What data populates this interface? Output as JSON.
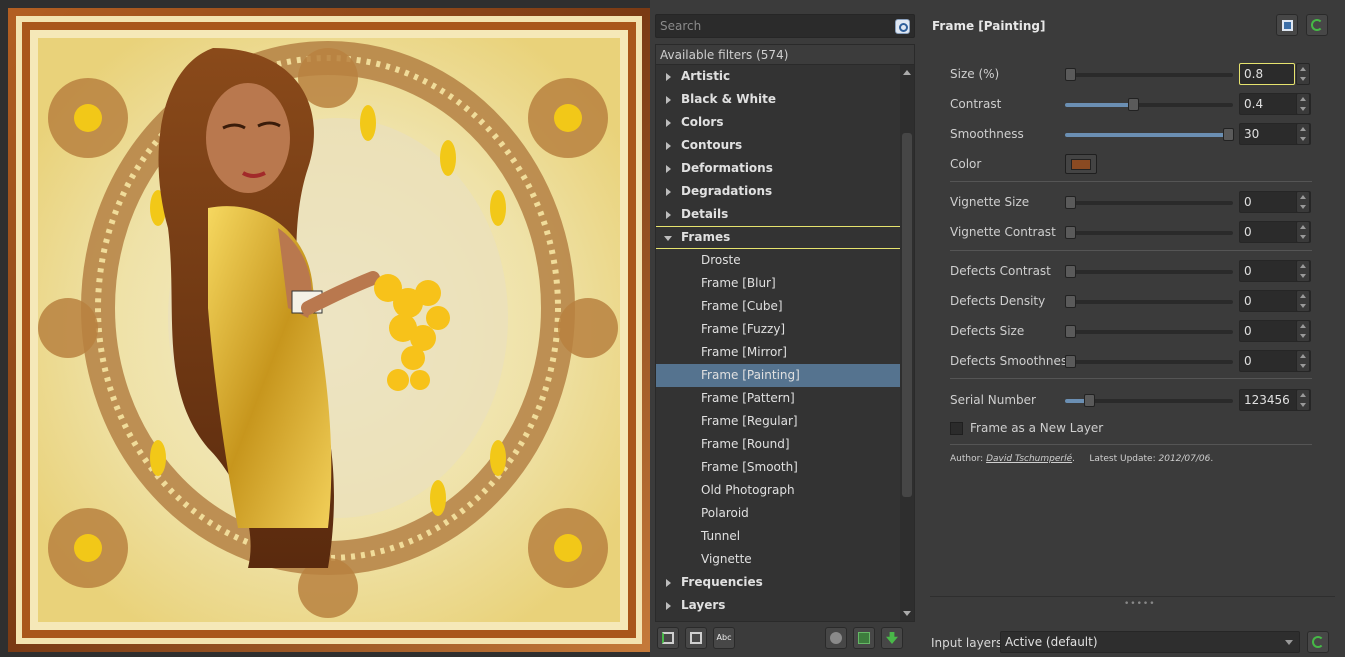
{
  "search": {
    "placeholder": "Search"
  },
  "tree": {
    "header": "Available filters (574)",
    "items": [
      {
        "label": "Artistic",
        "kind": "category",
        "open": false
      },
      {
        "label": "Black & White",
        "kind": "category",
        "open": false
      },
      {
        "label": "Colors",
        "kind": "category",
        "open": false
      },
      {
        "label": "Contours",
        "kind": "category",
        "open": false
      },
      {
        "label": "Deformations",
        "kind": "category",
        "open": false
      },
      {
        "label": "Degradations",
        "kind": "category",
        "open": false
      },
      {
        "label": "Details",
        "kind": "category",
        "open": false
      },
      {
        "label": "Frames",
        "kind": "category",
        "open": true
      },
      {
        "label": "Droste",
        "kind": "filter"
      },
      {
        "label": "Frame [Blur]",
        "kind": "filter"
      },
      {
        "label": "Frame [Cube]",
        "kind": "filter"
      },
      {
        "label": "Frame [Fuzzy]",
        "kind": "filter"
      },
      {
        "label": "Frame [Mirror]",
        "kind": "filter"
      },
      {
        "label": "Frame [Painting]",
        "kind": "filter",
        "selected": true
      },
      {
        "label": "Frame [Pattern]",
        "kind": "filter"
      },
      {
        "label": "Frame [Regular]",
        "kind": "filter"
      },
      {
        "label": "Frame [Round]",
        "kind": "filter"
      },
      {
        "label": "Frame [Smooth]",
        "kind": "filter"
      },
      {
        "label": "Old Photograph",
        "kind": "filter"
      },
      {
        "label": "Polaroid",
        "kind": "filter"
      },
      {
        "label": "Tunnel",
        "kind": "filter"
      },
      {
        "label": "Vignette",
        "kind": "filter"
      },
      {
        "label": "Frequencies",
        "kind": "category",
        "open": false
      },
      {
        "label": "Layers",
        "kind": "category",
        "open": false
      }
    ]
  },
  "tools": {
    "bottom_left": [
      "add-favorite-icon",
      "remove-favorite-icon",
      "rename-icon"
    ],
    "bottom_right": [
      "preview-icon",
      "grid-icon",
      "update-icon"
    ],
    "abc_label": "Abc"
  },
  "params": {
    "title": "Frame [Painting]",
    "rows": [
      {
        "label": "Size (%)",
        "value": "0.8",
        "fraction": 0.0
      },
      {
        "label": "Contrast",
        "value": "0.4",
        "fraction": 0.4
      },
      {
        "label": "Smoothness",
        "value": "30",
        "fraction": 1.0
      },
      {
        "label": "Vignette Size",
        "value": "0",
        "fraction": 0.0
      },
      {
        "label": "Vignette Contrast",
        "value": "0",
        "fraction": 0.0
      },
      {
        "label": "Defects Contrast",
        "value": "0",
        "fraction": 0.0
      },
      {
        "label": "Defects Density",
        "value": "0",
        "fraction": 0.0
      },
      {
        "label": "Defects Size",
        "value": "0",
        "fraction": 0.0
      },
      {
        "label": "Defects Smoothness",
        "value": "0",
        "fraction": 0.0
      },
      {
        "label": "Serial Number",
        "value": "123456",
        "fraction": 0.12
      }
    ],
    "color_label": "Color",
    "color_value": "#8a4a22",
    "checkbox_label": "Frame as a New Layer",
    "author_prefix": "Author:",
    "author_name": "David Tschumperlé",
    "update_prefix": "Latest Update:",
    "update_date": "2012/07/06"
  },
  "input": {
    "label": "Input layers",
    "value": "Active (default)"
  },
  "colors": {
    "accent_selected": "#55738f",
    "focus_outline": "#e6e36e",
    "slider_fill": "#6b8fb3"
  }
}
